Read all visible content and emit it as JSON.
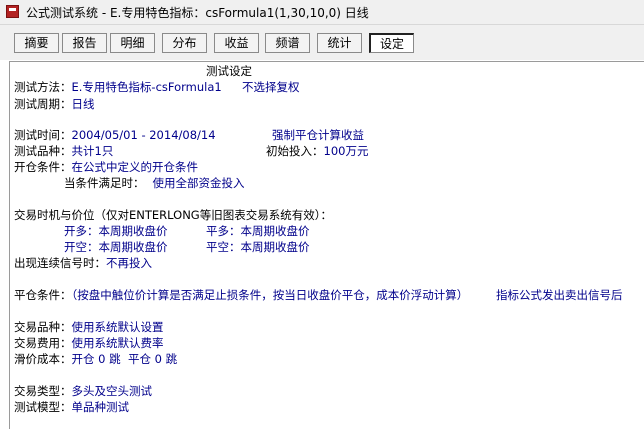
{
  "window": {
    "title": "公式测试系统 - E.专用特色指标：csFormula1(1,30,10,0) 日线"
  },
  "tabs": [
    "摘要",
    "报告",
    "明细",
    "分布",
    "收益",
    "频谱",
    "统计",
    "设定"
  ],
  "settings": {
    "heading": "测试设定",
    "method_label": "测试方法：",
    "method_value": "E.专用特色指标-csFormula1",
    "method_extra": "不选择复权",
    "period_label": "测试周期：",
    "period_value": "日线",
    "time_label": "测试时间：",
    "time_value": "2004/05/01 - 2014/08/14",
    "force_close": "强制平仓计算收益",
    "variety_label": "测试品种：",
    "variety_value": "共计1只",
    "initial_label": "初始投入：",
    "initial_value": "100万元",
    "open_label": "开仓条件：",
    "open_value": "在公式中定义的开仓条件",
    "when_met_label": "当条件满足时：",
    "when_met_value": "使用全部资金投入",
    "trade_timing_label": "交易时机与价位（仅对ENTERLONG等旧图表交易系统有效）：",
    "open_long_label": "开多：",
    "open_long_value": "本周期收盘价",
    "close_long_label": "平多：",
    "close_long_value": "本周期收盘价",
    "open_short_label": "开空：",
    "open_short_value": "本周期收盘价",
    "close_short_label": "平空：",
    "close_short_value": "本周期收盘价",
    "consecutive_label": "出现连续信号时：",
    "consecutive_value": "不再投入",
    "close_cond_label": "平仓条件：",
    "close_cond_value": "（按盘中触位价计算是否满足止损条件，按当日收盘价平仓，成本价浮动计算）",
    "close_cond_extra": "指标公式发出卖出信号后",
    "trade_variety_label": "交易品种：",
    "trade_variety_value": "使用系统默认设置",
    "trade_fee_label": "交易费用：",
    "trade_fee_value": "使用系统默认费率",
    "slippage_label": "滑价成本：",
    "slippage_value": "开仓 0 跳  平仓 0 跳",
    "trade_type_label": "交易类型：",
    "trade_type_value": "多头及空头测试",
    "model_label": "测试模型：",
    "model_value": "单品种测试"
  },
  "colors": {
    "value_text": "#00008b",
    "label_text": "#000000"
  },
  "icons": {
    "app": "app-icon"
  }
}
